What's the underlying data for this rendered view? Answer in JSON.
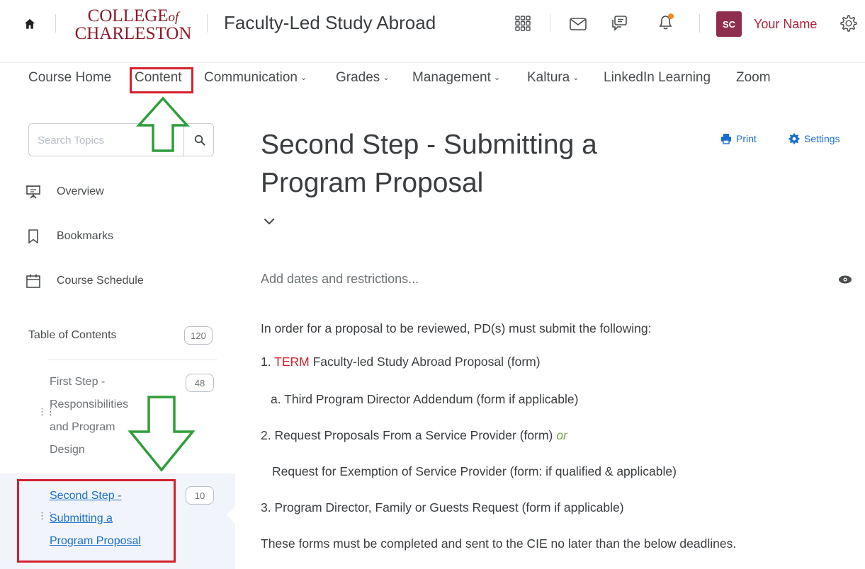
{
  "header": {
    "logo_line1": "COLLEGE",
    "logo_of": "of",
    "logo_line2": "CHARLESTON",
    "course_title": "Faculty-Led Study Abroad",
    "user_initials": "SC",
    "user_name": "Your Name"
  },
  "nav": {
    "items": [
      {
        "label": "Course Home",
        "has_menu": false
      },
      {
        "label": "Content",
        "has_menu": false
      },
      {
        "label": "Communication",
        "has_menu": true
      },
      {
        "label": "Grades",
        "has_menu": true
      },
      {
        "label": "Management",
        "has_menu": true
      },
      {
        "label": "Kaltura",
        "has_menu": true
      },
      {
        "label": "LinkedIn Learning",
        "has_menu": false
      },
      {
        "label": "Zoom",
        "has_menu": false
      }
    ],
    "menu_chevron": "⌄"
  },
  "sidebar": {
    "search_placeholder": "Search Topics",
    "items": [
      {
        "label": "Overview",
        "icon": "overview-icon"
      },
      {
        "label": "Bookmarks",
        "icon": "bookmark-icon"
      },
      {
        "label": "Course Schedule",
        "icon": "calendar-icon"
      }
    ],
    "toc": {
      "label": "Table of Contents",
      "count": "120",
      "modules": [
        {
          "lines": [
            "First Step -",
            "Responsibilities",
            "and Program",
            "Design"
          ],
          "count": "48",
          "active": false
        },
        {
          "lines": [
            "Second Step -",
            "Submitting a",
            "Program Proposal"
          ],
          "count": "10",
          "active": true
        }
      ]
    }
  },
  "main": {
    "title_line1": "Second Step - Submitting a",
    "title_line2": "Program Proposal",
    "print_label": "Print",
    "settings_label": "Settings",
    "add_dates": "Add dates and restrictions...",
    "intro": "In order for a proposal to be reviewed, PD(s) must submit the following:",
    "item1_prefix": "1. ",
    "item1_term": "TERM",
    "item1_rest": " Faculty-led Study Abroad Proposal (form)",
    "item1a": "a. Third Program Director Addendum (form if applicable)",
    "item2": "2. Request Proposals From a Service Provider (form) ",
    "item2_or": "or",
    "item2_alt": "Request for Exemption of Service Provider (form: if qualified & applicable)",
    "item3": "3. Program Director, Family or Guests Request (form if applicable)",
    "footer": "These forms must be completed and sent to the CIE no later than the below deadlines."
  },
  "colors": {
    "brand": "#8a1b2a",
    "highlight_red": "#d4222c",
    "link_blue": "#1b6dcc",
    "arrow_green": "#2e9e3a",
    "or_green": "#6aa84f",
    "avatar": "#8f2d4e"
  }
}
